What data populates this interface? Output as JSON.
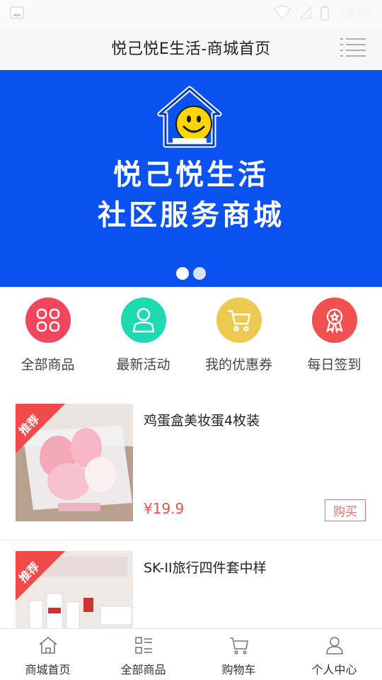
{
  "status_bar": {
    "time": "10:43",
    "icons": [
      "image-icon",
      "wifi-icon",
      "signal-icon",
      "battery-icon"
    ]
  },
  "header": {
    "title": "悦己悦E生活-商城首页",
    "menu_icon": "list-menu-icon"
  },
  "banner": {
    "line1": "悦己悦生活",
    "line2": "社区服务商城",
    "background": "#0a52f0",
    "slides": 2,
    "active_slide": 1
  },
  "quick_nav": [
    {
      "label": "全部商品",
      "icon": "grid-icon",
      "color": "#f0465e"
    },
    {
      "label": "最新活动",
      "icon": "person-icon",
      "color": "#1ed9b2"
    },
    {
      "label": "我的优惠券",
      "icon": "cart-icon",
      "color": "#ecca4f"
    },
    {
      "label": "每日签到",
      "icon": "award-icon",
      "color": "#f0504e"
    }
  ],
  "products": [
    {
      "badge": "推荐",
      "name": "鸡蛋盒美妆蛋4枚装",
      "price": "¥19.9",
      "buy_label": "购买"
    },
    {
      "badge": "推荐",
      "name": "SK-II旅行四件套中样",
      "price": "",
      "buy_label": ""
    }
  ],
  "tab_bar": [
    {
      "label": "商城首页",
      "icon": "home-icon"
    },
    {
      "label": "全部商品",
      "icon": "category-list-icon"
    },
    {
      "label": "购物车",
      "icon": "cart-icon"
    },
    {
      "label": "个人中心",
      "icon": "user-icon"
    }
  ],
  "colors": {
    "accent_red": "#ec5050",
    "banner_blue": "#0a52f0"
  }
}
